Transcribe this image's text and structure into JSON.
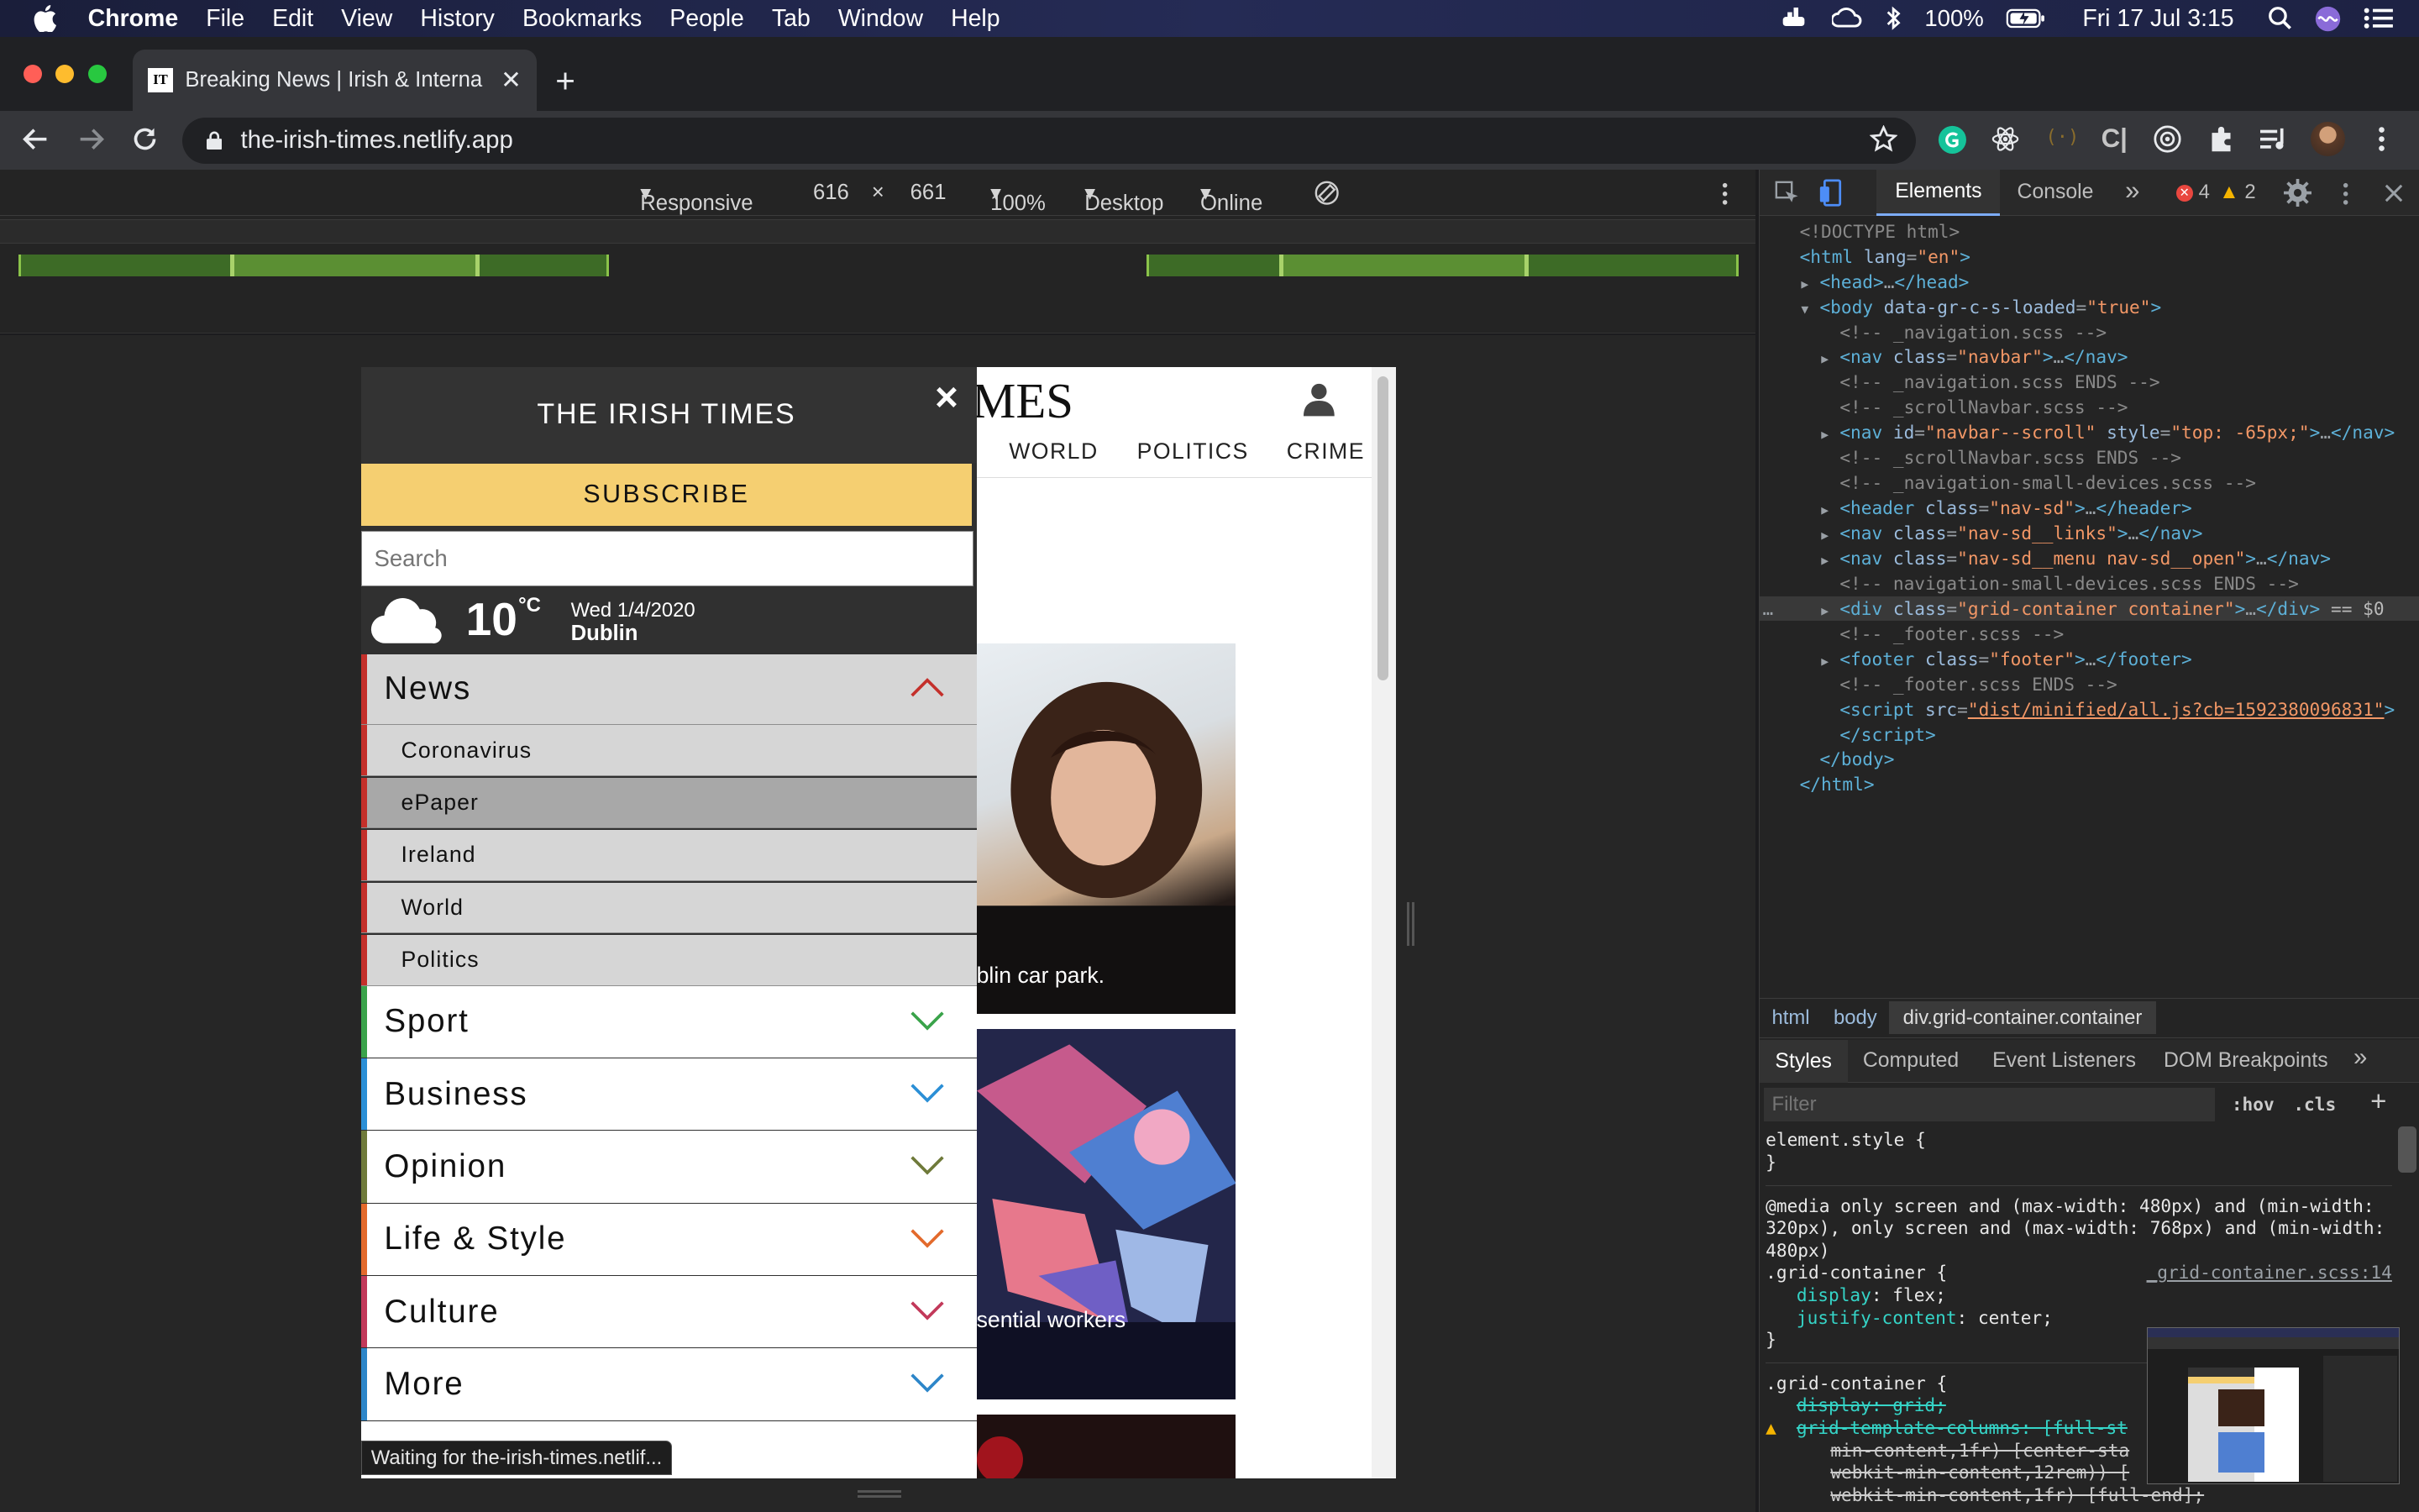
{
  "menubar": {
    "items": [
      "Chrome",
      "File",
      "Edit",
      "View",
      "History",
      "Bookmarks",
      "People",
      "Tab",
      "Window",
      "Help"
    ],
    "battery": "100%",
    "clock": "Fri 17 Jul  3:15"
  },
  "browser": {
    "tab_favicon": "IT",
    "tab_title": "Breaking News | Irish & Interna",
    "url": "the-irish-times.netlify.app",
    "status": "Waiting for the-irish-times.netlif..."
  },
  "device_toolbar": {
    "mode": "Responsive",
    "width": "616",
    "times": "×",
    "height": "661",
    "zoom": "100%",
    "device_type": "Desktop",
    "throttle": "Online"
  },
  "site": {
    "logo_partial": "MES",
    "nav": [
      "WORLD",
      "POLITICS",
      "CRIME"
    ],
    "caption1": "blin car park.",
    "caption2": "sential workers"
  },
  "menu": {
    "title": "THE IRISH TIMES",
    "close": "×",
    "subscribe": "SUBSCRIBE",
    "search_placeholder": "Search",
    "weather": {
      "temp": "10",
      "unit": "°C",
      "date": "Wed 1/4/2020",
      "city": "Dublin"
    },
    "news": {
      "label": "News",
      "items": [
        "Coronavirus",
        "ePaper",
        "Ireland",
        "World",
        "Politics"
      ]
    },
    "sections": [
      {
        "label": "Sport",
        "color": "#3aa34a"
      },
      {
        "label": "Business",
        "color": "#2b8fd6"
      },
      {
        "label": "Opinion",
        "color": "#6f7a3a"
      },
      {
        "label": "Life & Style",
        "color": "#e36a2c"
      },
      {
        "label": "Culture",
        "color": "#c2395a"
      },
      {
        "label": "More",
        "color": "#2d86c9"
      }
    ]
  },
  "devtools": {
    "tabs": [
      "Elements",
      "Console",
      "»"
    ],
    "errors": "4",
    "warnings": "2",
    "breadcrumb": [
      "html",
      "body",
      "div.grid-container.container"
    ],
    "style_tabs": [
      "Styles",
      "Computed",
      "Event Listeners",
      "DOM Breakpoints",
      "»"
    ],
    "filter_placeholder": "Filter",
    "hov": ":hov",
    "cls": ".cls",
    "dom_lines": [
      {
        "indent": 0,
        "arrow": "",
        "html": "<span class='cmt'>&lt;!DOCTYPE html&gt;</span>"
      },
      {
        "indent": 0,
        "arrow": "",
        "html": "<span class='tag'>&lt;html</span> <span class='attr'>lang</span>=<span class='val'>\"en\"</span><span class='tag'>&gt;</span>"
      },
      {
        "indent": 1,
        "arrow": "▶",
        "html": "<span class='tag'>&lt;head&gt;</span>…<span class='tag'>&lt;/head&gt;</span>"
      },
      {
        "indent": 1,
        "arrow": "▼",
        "html": "<span class='tag'>&lt;body</span> <span class='attr'>data-gr-c-s-loaded</span>=<span class='val'>\"true\"</span><span class='tag'>&gt;</span>"
      },
      {
        "indent": 2,
        "arrow": "",
        "html": "<span class='cmt'>&lt;!-- _navigation.scss --&gt;</span>"
      },
      {
        "indent": 2,
        "arrow": "▶",
        "html": "<span class='tag'>&lt;nav</span> <span class='attr'>class</span>=<span class='val'>\"navbar\"</span><span class='tag'>&gt;</span>…<span class='tag'>&lt;/nav&gt;</span>"
      },
      {
        "indent": 2,
        "arrow": "",
        "html": "<span class='cmt'>&lt;!-- _navigation.scss ENDS --&gt;</span>"
      },
      {
        "indent": 2,
        "arrow": "",
        "html": "<span class='cmt'>&lt;!-- _scrollNavbar.scss --&gt;</span>"
      },
      {
        "indent": 2,
        "arrow": "▶",
        "html": "<span class='tag'>&lt;nav</span> <span class='attr'>id</span>=<span class='val'>\"navbar--scroll\"</span> <span class='attr'>style</span>=<span class='val'>\"top: -65px;\"</span><span class='tag'>&gt;</span>…<span class='tag'>&lt;/nav&gt;</span>"
      },
      {
        "indent": 2,
        "arrow": "",
        "html": "<span class='cmt'>&lt;!-- _scrollNavbar.scss ENDS --&gt;</span>"
      },
      {
        "indent": 2,
        "arrow": "",
        "html": "<span class='cmt'>&lt;!-- _navigation-small-devices.scss --&gt;</span>"
      },
      {
        "indent": 2,
        "arrow": "▶",
        "html": "<span class='tag'>&lt;header</span> <span class='attr'>class</span>=<span class='val'>\"nav-sd\"</span><span class='tag'>&gt;</span>…<span class='tag'>&lt;/header&gt;</span>"
      },
      {
        "indent": 2,
        "arrow": "▶",
        "html": "<span class='tag'>&lt;nav</span> <span class='attr'>class</span>=<span class='val'>\"nav-sd__links\"</span><span class='tag'>&gt;</span>…<span class='tag'>&lt;/nav&gt;</span>"
      },
      {
        "indent": 2,
        "arrow": "▶",
        "html": "<span class='tag'>&lt;nav</span> <span class='attr'>class</span>=<span class='val'>\"nav-sd__menu nav-sd__open\"</span><span class='tag'>&gt;</span>…<span class='tag'>&lt;/nav&gt;</span>"
      },
      {
        "indent": 2,
        "arrow": "",
        "html": "<span class='cmt'>&lt;!-- navigation-small-devices.scss ENDS --&gt;</span>"
      },
      {
        "indent": 2,
        "arrow": "▶",
        "html": "<span class='tag'>&lt;div</span> <span class='attr'>class</span>=<span class='val'>\"grid-container container\"</span><span class='tag'>&gt;</span>…<span class='tag'>&lt;/div&gt;</span> <span style='color:#bbb'>== $0</span>",
        "selected": true
      },
      {
        "indent": 2,
        "arrow": "",
        "html": "<span class='cmt'>&lt;!-- _footer.scss --&gt;</span>"
      },
      {
        "indent": 2,
        "arrow": "▶",
        "html": "<span class='tag'>&lt;footer</span> <span class='attr'>class</span>=<span class='val'>\"footer\"</span><span class='tag'>&gt;</span>…<span class='tag'>&lt;/footer&gt;</span>"
      },
      {
        "indent": 2,
        "arrow": "",
        "html": "<span class='cmt'>&lt;!-- _footer.scss ENDS --&gt;</span>"
      },
      {
        "indent": 2,
        "arrow": "",
        "html": "<span class='tag'>&lt;script</span> <span class='attr'>src</span>=<span class='val' style='text-decoration:underline'>\"dist/minified/all.js?cb=1592380096831\"</span><span class='tag'>&gt;</span>"
      },
      {
        "indent": 2,
        "arrow": "",
        "html": "<span class='tag'>&lt;/script&gt;</span>"
      },
      {
        "indent": 1,
        "arrow": "",
        "html": "<span class='tag'>&lt;/body&gt;</span>"
      },
      {
        "indent": 0,
        "arrow": "",
        "html": "<span class='tag'>&lt;/html&gt;</span>"
      }
    ],
    "styles": {
      "element_style": "element.style {",
      "close_brace": "}",
      "media": "@media only screen and (max-width: 480px) and (min-width: 320px), only screen and (max-width: 768px) and (min-width: 480px)",
      "rule1_selector": ".grid-container {",
      "rule1_source": "_grid-container.scss:14",
      "rule1_props": [
        [
          "display",
          "flex"
        ],
        [
          "justify-content",
          "center"
        ]
      ],
      "rule2_selector": ".grid-container {",
      "rule2_prop1": "display: grid;",
      "rule2_prop2": "grid-template-columns: [full-st",
      "rule2_cont1": "min-content,1fr) [center-sta",
      "rule2_cont2": "webkit-min-content,12rem)) [",
      "rule2_cont3": "webkit-min-content,1fr) [full-end];"
    }
  }
}
